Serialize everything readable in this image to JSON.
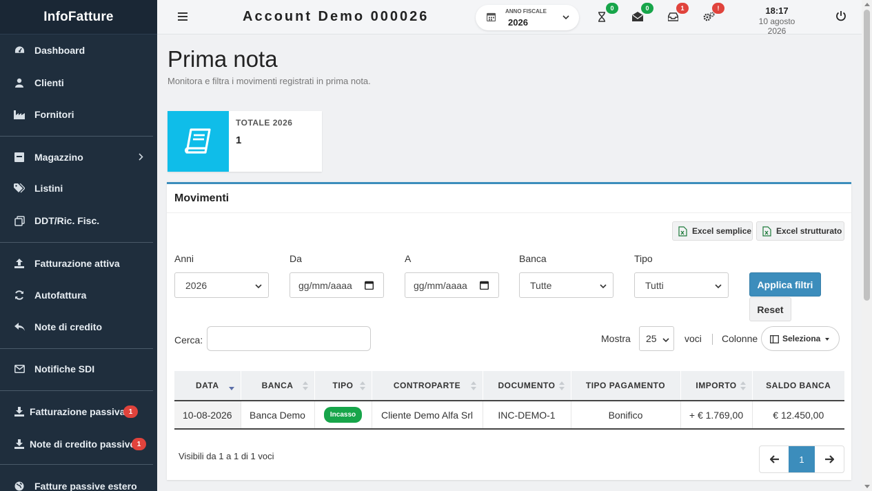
{
  "brand": "InfoFatture",
  "sidebar": {
    "items": [
      {
        "label": "Dashboard",
        "icon": "dashboard-icon"
      },
      {
        "label": "Clienti",
        "icon": "user-icon"
      },
      {
        "label": "Fornitori",
        "icon": "industry-icon"
      },
      {
        "label": "Magazzino",
        "icon": "archive-icon"
      },
      {
        "label": "Listini",
        "icon": "tags-icon"
      },
      {
        "label": "DDT/Ric. Fisc.",
        "icon": "copy-icon"
      },
      {
        "label": "Fatturazione attiva",
        "icon": "upload-icon"
      },
      {
        "label": "Autofattura",
        "icon": "refresh-icon"
      },
      {
        "label": "Note di credito",
        "icon": "reply-icon"
      },
      {
        "label": "Notifiche SDI",
        "icon": "envelope-icon"
      },
      {
        "label": "Fatturazione passiva",
        "icon": "download-icon",
        "badge": "1"
      },
      {
        "label": "Note di credito passive",
        "icon": "download-icon",
        "badge": "1"
      },
      {
        "label": "Fatture passive estero",
        "icon": "globe-icon"
      }
    ]
  },
  "topbar": {
    "account": "Account Demo 000026",
    "fiscal_year_label": "ANNO FISCALE",
    "fiscal_year_value": "2026",
    "badges": {
      "hourglass": "0",
      "mail": "0",
      "inbox": "1",
      "settings": "!"
    },
    "time": "18:17",
    "date": "10 agosto 2026"
  },
  "page": {
    "title": "Prima nota",
    "subtitle": "Monitora e filtra i movimenti registrati in prima nota."
  },
  "stat": {
    "label": "TOTALE 2026",
    "value": "1"
  },
  "card": {
    "title": "Movimenti",
    "excel_simple": "Excel semplice",
    "excel_structured": "Excel strutturato"
  },
  "filters": {
    "anni_label": "Anni",
    "anni_value": "2026",
    "da_label": "Da",
    "da_value": "gg/mm/aaaa",
    "a_label": "A",
    "a_value": "gg/mm/aaaa",
    "banca_label": "Banca",
    "banca_value": "Tutte",
    "tipo_label": "Tipo",
    "tipo_value": "Tutti",
    "apply": "Applica filtri",
    "reset": "Reset"
  },
  "controls": {
    "search_label": "Cerca:",
    "mostra": "Mostra",
    "mostra_value": "25",
    "voci": "voci",
    "colonne": "Colonne",
    "seleziona": "Seleziona"
  },
  "table": {
    "headers": [
      "DATA",
      "BANCA",
      "TIPO",
      "CONTROPARTE",
      "DOCUMENTO",
      "TIPO PAGAMENTO",
      "IMPORTO",
      "SALDO BANCA"
    ],
    "rows": [
      [
        "10-08-2026",
        "Banca Demo",
        "Incasso",
        "Cliente Demo Alfa Srl",
        "INC-DEMO-1",
        "Bonifico",
        "+ € 1.769,00",
        "€ 12.450,00"
      ]
    ]
  },
  "footer": {
    "info": "Visibili da 1 a 1 di 1 voci",
    "page": "1"
  },
  "colors": {
    "sidebar": "#1f2e3d",
    "accent": "#3c8dbc",
    "stat": "#0fbde9",
    "success": "#17a54a",
    "danger": "#e0433c"
  }
}
